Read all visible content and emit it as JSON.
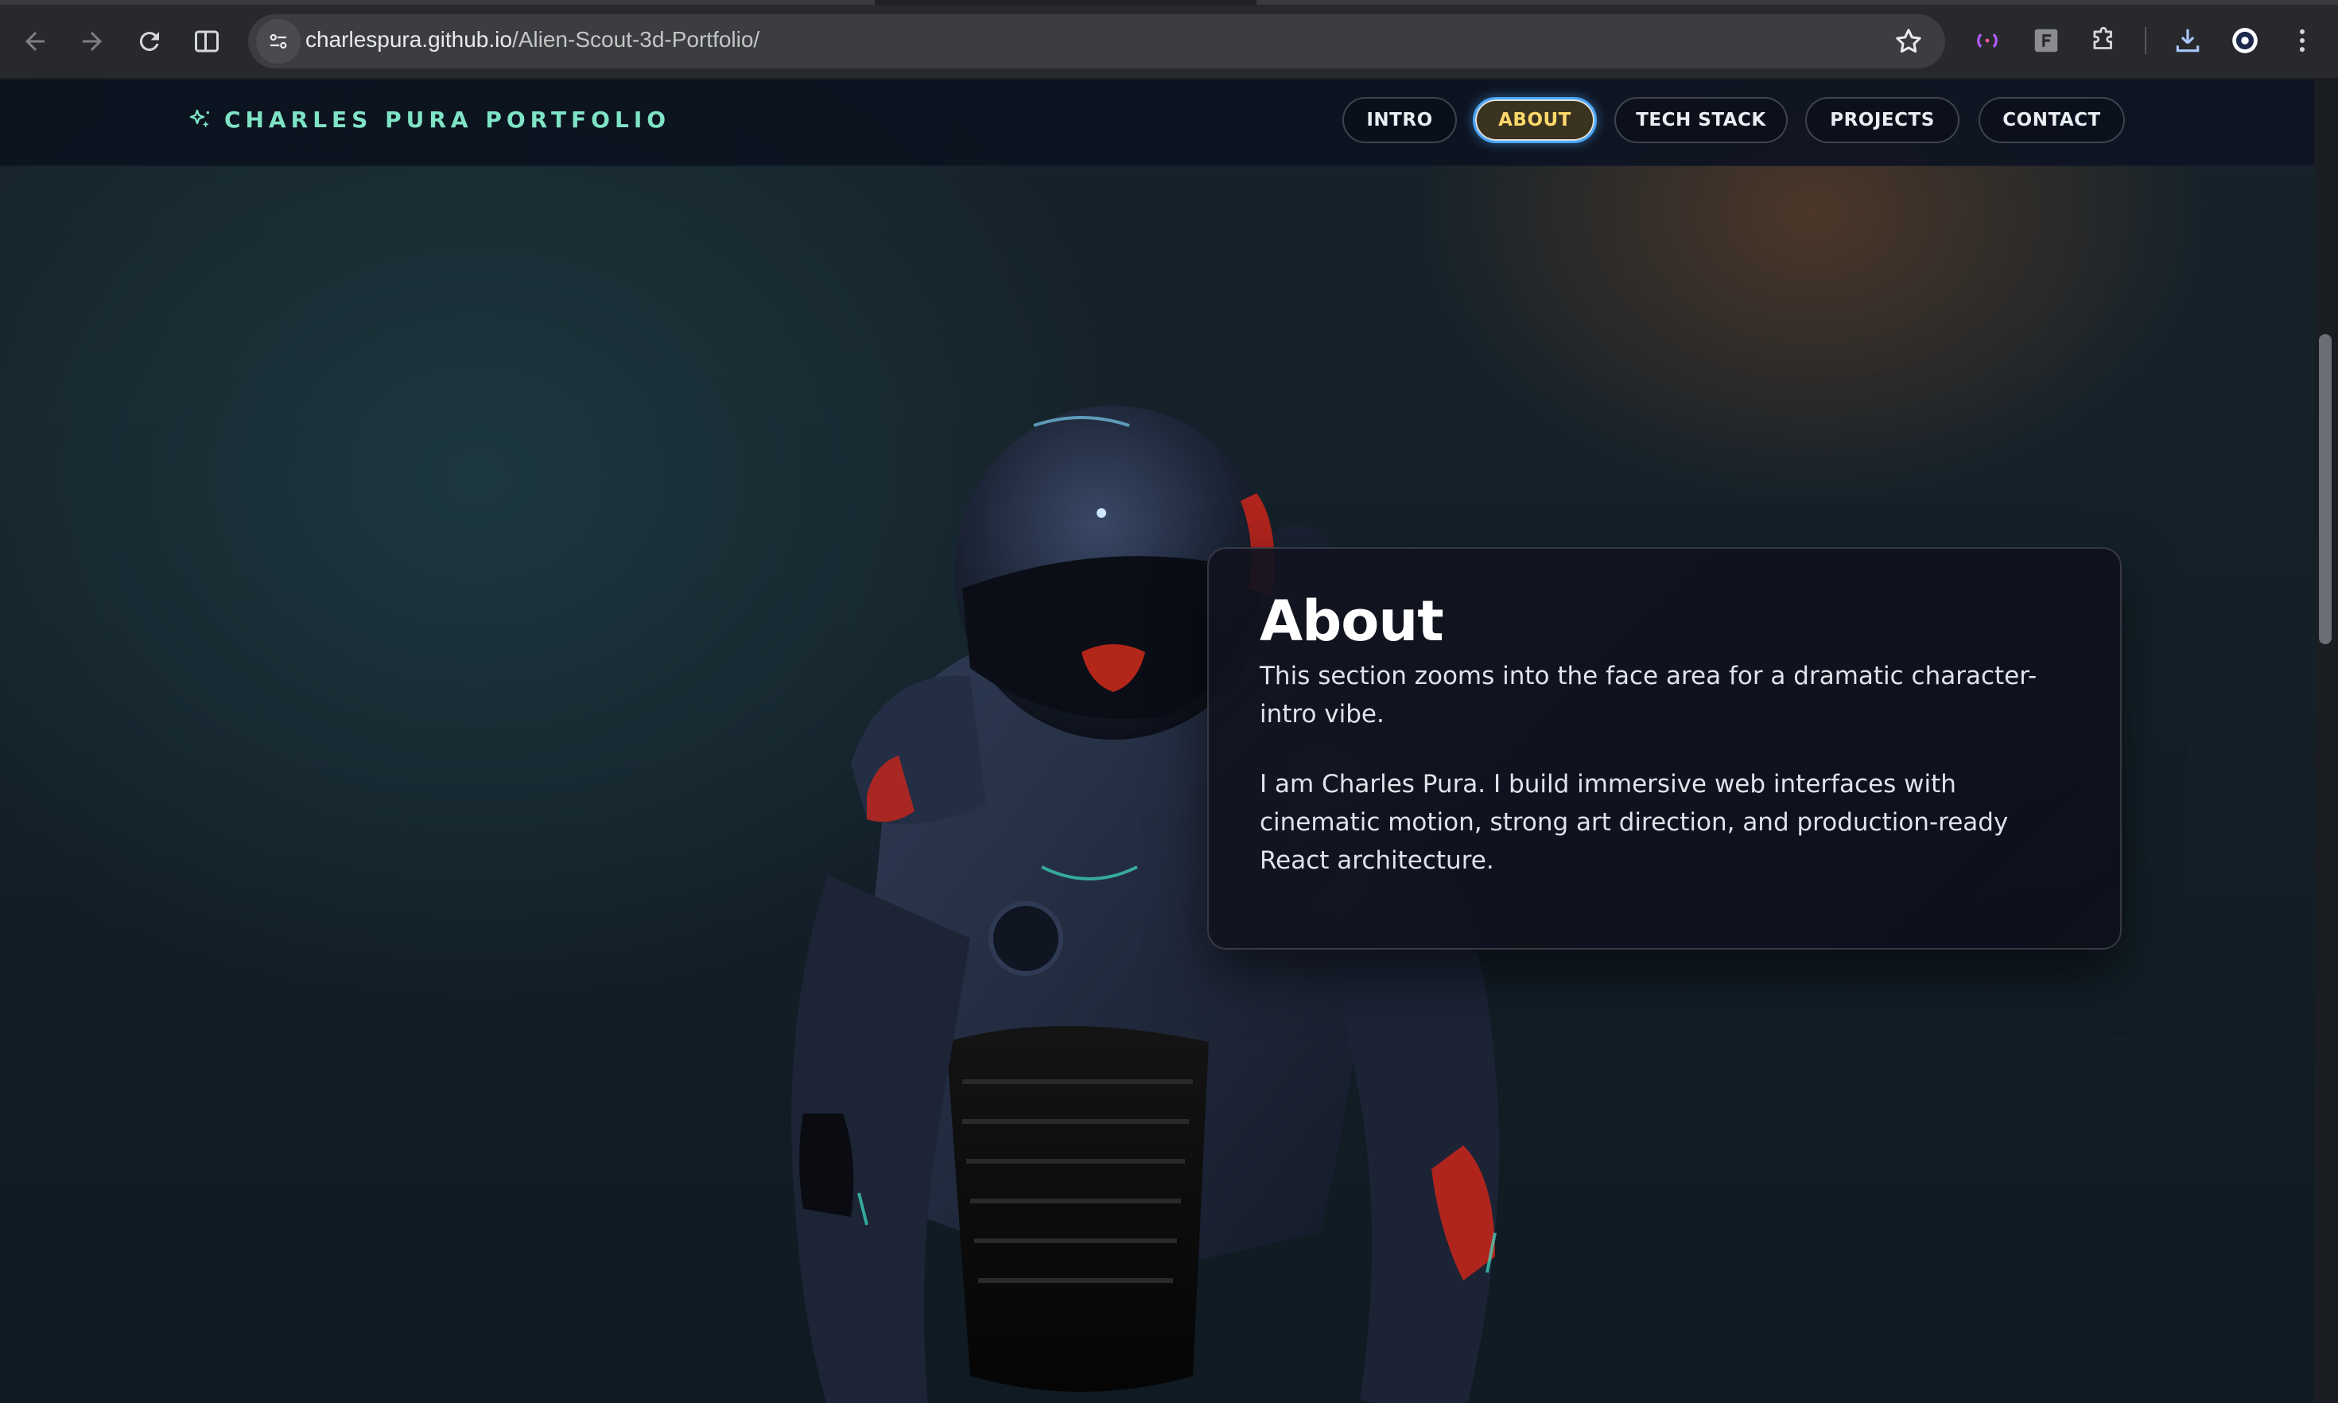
{
  "browser": {
    "url_host": "charlespura.github.io",
    "url_path": "/Alien-Scout-3d-Portfolio/"
  },
  "site": {
    "brand": "CHARLES PURA PORTFOLIO",
    "nav": [
      {
        "label": "INTRO",
        "active": false
      },
      {
        "label": "ABOUT",
        "active": true
      },
      {
        "label": "TECH STACK",
        "active": false
      },
      {
        "label": "PROJECTS",
        "active": false
      },
      {
        "label": "CONTACT",
        "active": false
      }
    ]
  },
  "about": {
    "title": "About",
    "paragraph_1": "This section zooms into the face area for a dramatic character-intro vibe.",
    "paragraph_2": "I am Charles Pura. I build immersive web interfaces with cinematic motion, strong art direction, and production-ready React architecture."
  },
  "colors": {
    "brand_accent": "#7fe3c6",
    "active_nav_text": "#ffd86b",
    "active_nav_ring": "#4aa8ff",
    "armor_highlight": "#d62a1f"
  }
}
